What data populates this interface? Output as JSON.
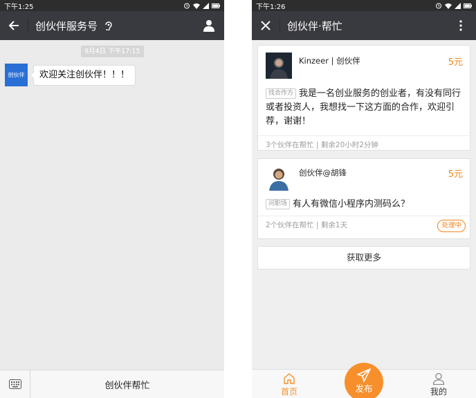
{
  "left": {
    "status": {
      "time": "下午1:25"
    },
    "header": {
      "title": "创伙伴服务号"
    },
    "chat": {
      "timestamp": "9月4日 下午17:15",
      "sender_logo": "创伙伴",
      "message": "欢迎关注创伙伴！！！"
    },
    "bottom": {
      "menu_label": "创伙伴帮忙"
    }
  },
  "right": {
    "status": {
      "time": "下午1:26"
    },
    "header": {
      "title": "创伙伴·帮忙"
    },
    "posts": [
      {
        "author": "Kinzeer | 创伙伴",
        "reward": "5元",
        "tag": "找合作方",
        "text": "我是一名创业服务的创业者，有没有同行或者投资人，我想找一下这方面的合作，欢迎引荐，谢谢！",
        "footer": "3个伙伴在帮忙 | 剩余20小时2分钟"
      },
      {
        "author": "创伙伴@胡锋",
        "reward": "5元",
        "tag": "问职场",
        "text": "有人有微信小程序内测码么？",
        "footer": "2个伙伴在帮忙 | 剩余1天",
        "status": "处理中"
      }
    ],
    "load_more": "获取更多",
    "tabs": [
      {
        "label": "首页",
        "icon": "home-icon"
      },
      {
        "label": "发布",
        "icon": "send-icon"
      },
      {
        "label": "我的",
        "icon": "user-icon"
      }
    ]
  },
  "colors": {
    "accent": "#f7902c",
    "header_bg": "#393a3f",
    "status_bg": "#2d2d2d"
  }
}
